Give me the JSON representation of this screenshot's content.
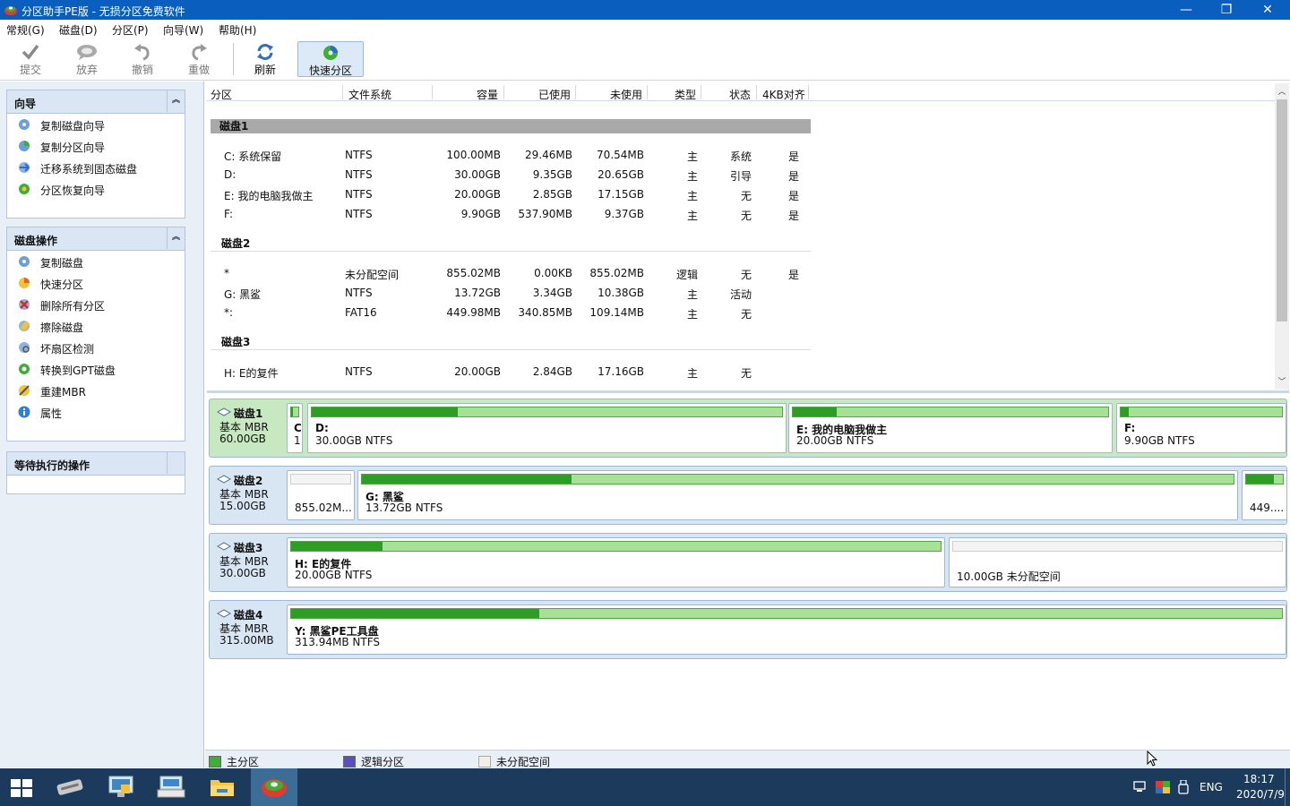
{
  "window": {
    "title": "分区助手PE版 - 无损分区免费软件",
    "minimize": "—",
    "restore": "❐",
    "close": "✕"
  },
  "menu": [
    "常规(G)",
    "磁盘(D)",
    "分区(P)",
    "向导(W)",
    "帮助(H)"
  ],
  "toolbar": {
    "commit": "提交",
    "discard": "放弃",
    "undo": "撤销",
    "redo": "重做",
    "refresh": "刷新",
    "quick_partition": "快速分区"
  },
  "wizard_panel": {
    "title": "向导",
    "collapse": "︽",
    "items": [
      "复制磁盘向导",
      "复制分区向导",
      "迁移系统到固态磁盘",
      "分区恢复向导"
    ]
  },
  "disk_ops_panel": {
    "title": "磁盘操作",
    "collapse": "︽",
    "items": [
      "复制磁盘",
      "快速分区",
      "删除所有分区",
      "擦除磁盘",
      "坏扇区检测",
      "转换到GPT磁盘",
      "重建MBR",
      "属性"
    ]
  },
  "pending_panel": {
    "title": "等待执行的操作"
  },
  "grid": {
    "columns": [
      "分区",
      "文件系统",
      "容量",
      "已使用",
      "未使用",
      "类型",
      "状态",
      "4KB对齐"
    ],
    "disks": [
      {
        "name": "磁盘1",
        "rows": [
          [
            "C: 系统保留",
            "NTFS",
            "100.00MB",
            "29.46MB",
            "70.54MB",
            "主",
            "系统",
            "是"
          ],
          [
            "D:",
            "NTFS",
            "30.00GB",
            "9.35GB",
            "20.65GB",
            "主",
            "引导",
            "是"
          ],
          [
            "E: 我的电脑我做主",
            "NTFS",
            "20.00GB",
            "2.85GB",
            "17.15GB",
            "主",
            "无",
            "是"
          ],
          [
            "F:",
            "NTFS",
            "9.90GB",
            "537.90MB",
            "9.37GB",
            "主",
            "无",
            "是"
          ]
        ]
      },
      {
        "name": "磁盘2",
        "rows": [
          [
            "*",
            "未分配空间",
            "855.02MB",
            "0.00KB",
            "855.02MB",
            "逻辑",
            "无",
            "是"
          ],
          [
            "G: 黑鲨",
            "NTFS",
            "13.72GB",
            "3.34GB",
            "10.38GB",
            "主",
            "活动",
            ""
          ],
          [
            "*:",
            "FAT16",
            "449.98MB",
            "340.85MB",
            "109.14MB",
            "主",
            "无",
            ""
          ]
        ]
      },
      {
        "name": "磁盘3",
        "rows": [
          [
            "H: E的复件",
            "NTFS",
            "20.00GB",
            "2.84GB",
            "17.16GB",
            "主",
            "无",
            ""
          ]
        ]
      }
    ]
  },
  "map": [
    {
      "name": "磁盘1",
      "type": "基本 MBR",
      "size": "60.00GB",
      "partitions": [
        {
          "label": "C",
          "size": "1",
          "used_pct": 30,
          "unalloc": false
        },
        {
          "label": "D:",
          "size": "30.00GB NTFS",
          "used_pct": 31,
          "unalloc": false
        },
        {
          "label": "E: 我的电脑我做主",
          "size": "20.00GB NTFS",
          "used_pct": 14,
          "unalloc": false
        },
        {
          "label": "F:",
          "size": "9.90GB NTFS",
          "used_pct": 5,
          "unalloc": false
        }
      ]
    },
    {
      "name": "磁盘2",
      "type": "基本 MBR",
      "size": "15.00GB",
      "partitions": [
        {
          "label": "",
          "size": "855.02M...",
          "used_pct": 0,
          "unalloc": true
        },
        {
          "label": "G: 黑鲨",
          "size": "13.72GB NTFS",
          "used_pct": 24,
          "unalloc": false
        },
        {
          "label": "",
          "size": "449....",
          "used_pct": 76,
          "unalloc": false
        }
      ]
    },
    {
      "name": "磁盘3",
      "type": "基本 MBR",
      "size": "30.00GB",
      "partitions": [
        {
          "label": "H: E的复件",
          "size": "20.00GB NTFS",
          "used_pct": 14,
          "unalloc": false
        },
        {
          "label": "",
          "size": "10.00GB 未分配空间",
          "used_pct": 0,
          "unalloc": true
        }
      ]
    },
    {
      "name": "磁盘4",
      "type": "基本 MBR",
      "size": "315.00MB",
      "partitions": [
        {
          "label": "Y: 黑鲨PE工具盘",
          "size": "313.94MB NTFS",
          "used_pct": 25,
          "unalloc": false
        }
      ]
    }
  ],
  "legend": {
    "primary": "主分区",
    "logical": "逻辑分区",
    "unallocated": "未分配空间"
  },
  "colors": {
    "primary": "#3fae35",
    "logical": "#5a4fc0",
    "unallocated": "#f2efe6",
    "titlebar": "#0a5ebd",
    "taskbar": "#1b3a5c"
  },
  "taskbar": {
    "lang": "ENG",
    "time": "18:17",
    "date": "2020/7/9"
  }
}
